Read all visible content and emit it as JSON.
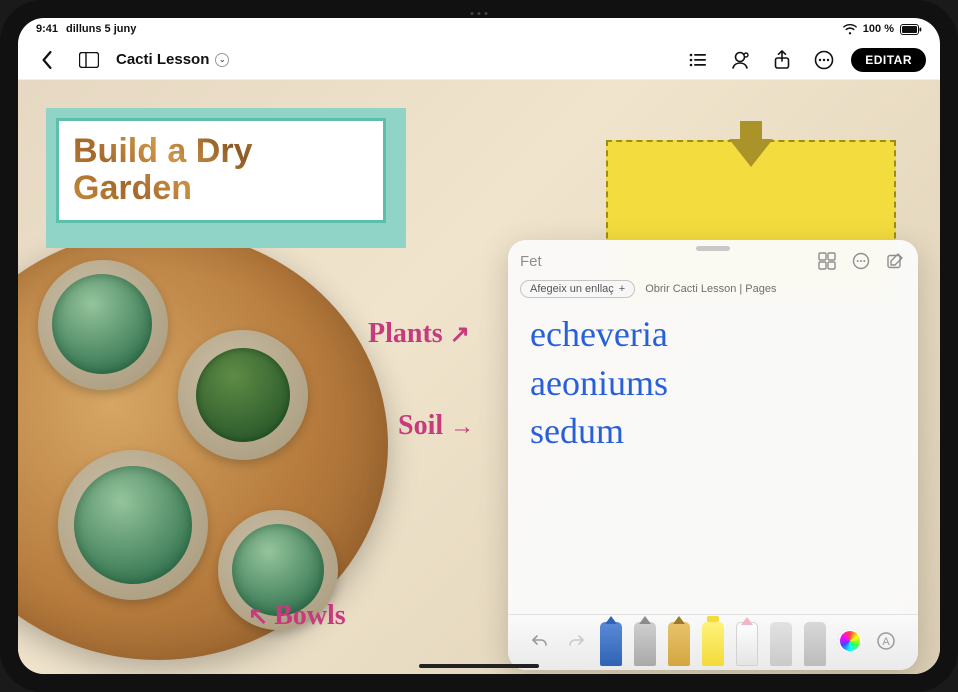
{
  "statusbar": {
    "time": "9:41",
    "date": "dilluns 5 juny",
    "battery_text": "100 %"
  },
  "toolbar": {
    "document_title": "Cacti Lesson",
    "edit_label": "EDITAR"
  },
  "document": {
    "headline": "Build a Dry Garden",
    "annotations": {
      "plants": "Plants",
      "soil": "Soil",
      "bowls": "Bowls"
    }
  },
  "quicknote": {
    "done_label": "Fet",
    "add_link_label": "Afegeix un enllaç",
    "open_source_label": "Obrir Cacti Lesson | Pages",
    "lines": [
      "echeveria",
      "aeoniums",
      "sedum"
    ]
  }
}
